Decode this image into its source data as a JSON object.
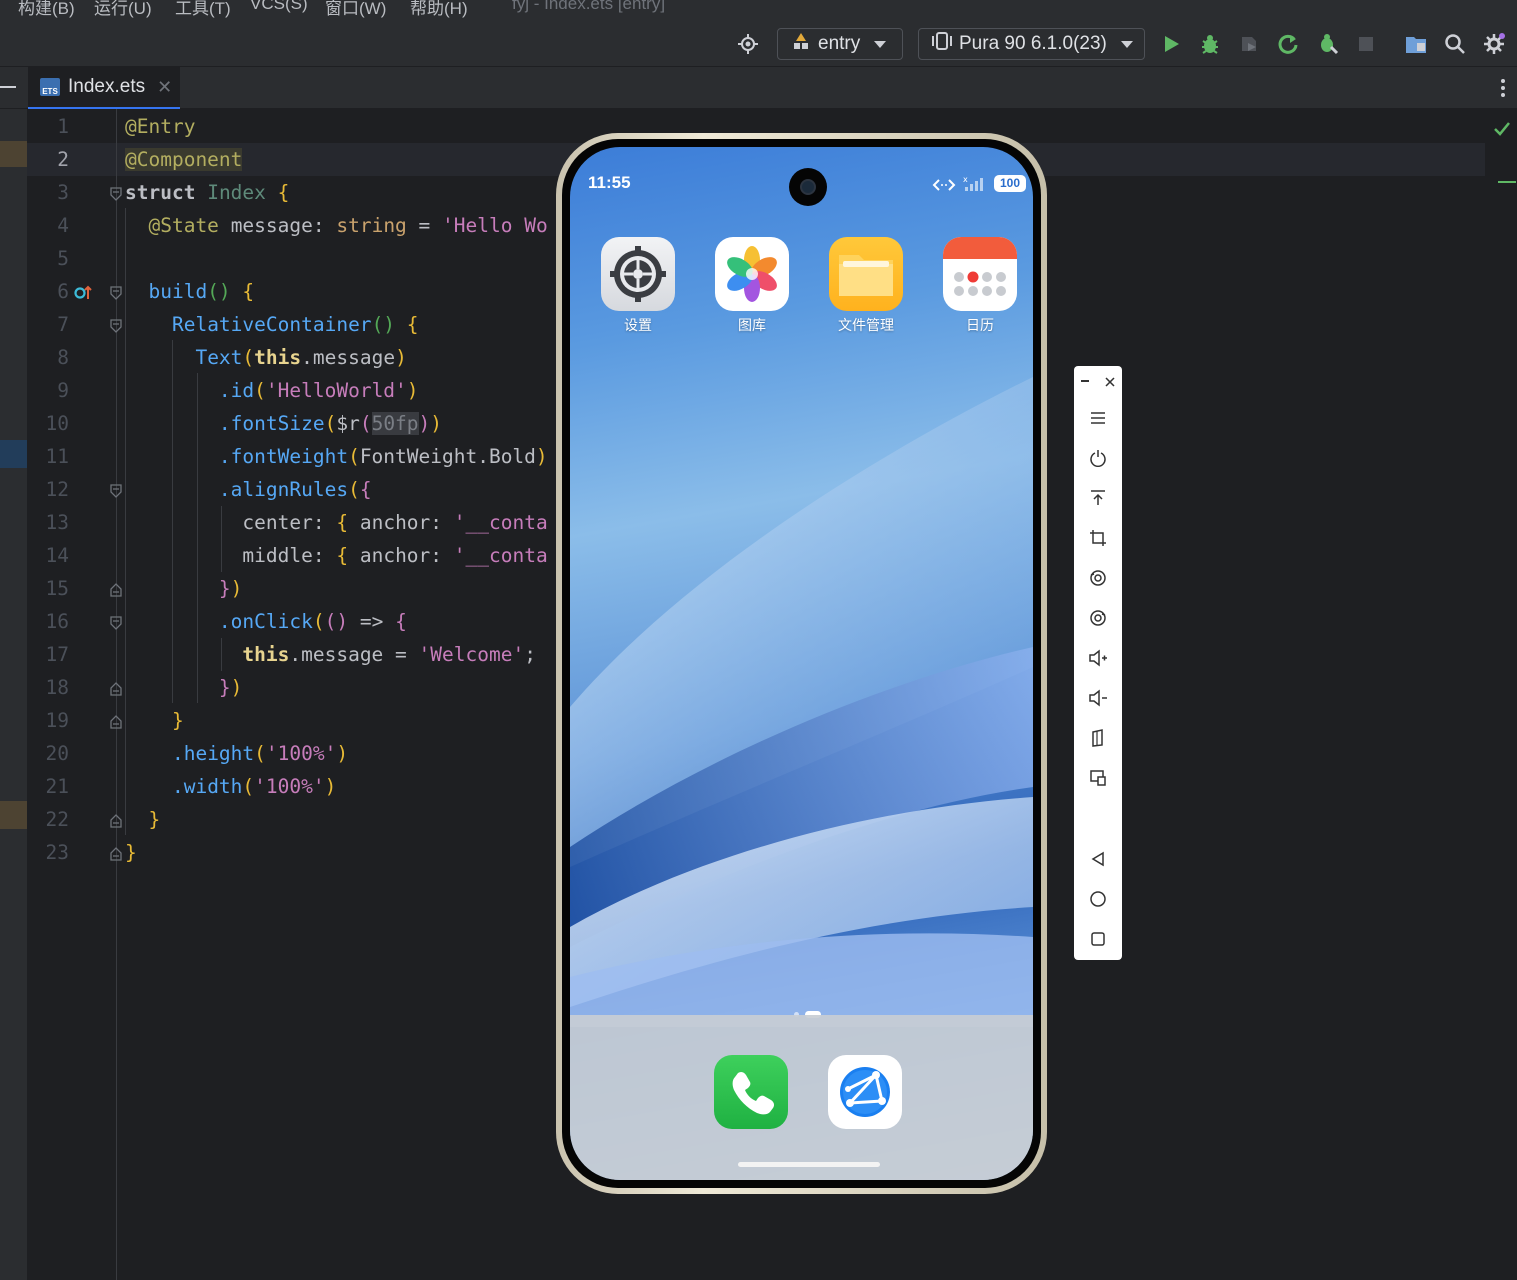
{
  "menubar": {
    "items": [
      "构建(B)",
      "运行(U)",
      "工具(T)",
      "VCS(S)",
      "窗口(W)",
      "帮助(H)"
    ],
    "window_title": "fyj - Index.ets [entry]"
  },
  "toolbar": {
    "module_combo": "entry",
    "device_combo": "Pura 90 6.1.0(23)"
  },
  "tabs": [
    {
      "label": "Index.ets",
      "active": true,
      "icon": "ets-file-icon",
      "badge": "ETS"
    }
  ],
  "editor": {
    "line_numbers": [
      "1",
      "2",
      "3",
      "4",
      "5",
      "6",
      "7",
      "8",
      "9",
      "10",
      "11",
      "12",
      "13",
      "14",
      "15",
      "16",
      "17",
      "18",
      "19",
      "20",
      "21",
      "22",
      "23"
    ],
    "lines": {
      "l1": "@Entry",
      "l2": "@Component",
      "l3_kw": "struct",
      "l3_name": "Index",
      "l3_brace": "{",
      "l4_ann": "@State",
      "l4_name": "message",
      "l4_type": "string",
      "l4_str": "'Hello Wo",
      "l6_fn": "build",
      "l7_fn": "RelativeContainer",
      "l8_fn": "Text",
      "l8_this": "this",
      "l8_prop": ".message",
      "l9_fn": ".id",
      "l9_str": "'HelloWorld'",
      "l10_fn": ".fontSize",
      "l10_r": "$r",
      "l10_arg": "50fp",
      "l11_fn": ".fontWeight",
      "l11_arg": "FontWeight.Bold",
      "l12_fn": ".alignRules",
      "l13_key": "center",
      "l13_anchor": "anchor",
      "l13_str": "'__conta",
      "l14_key": "middle",
      "l14_anchor": "anchor",
      "l14_str": "'__conta",
      "l16_fn": ".onClick",
      "l17_this": "this",
      "l17_prop": ".message",
      "l17_str": "'Welcome'",
      "l20_fn": ".height",
      "l20_str": "'100%'",
      "l21_fn": ".width",
      "l21_str": "'100%'"
    }
  },
  "phone": {
    "status_time": "11:55",
    "battery": "100",
    "apps": [
      {
        "label": "设置",
        "icon": "settings-icon"
      },
      {
        "label": "图库",
        "icon": "gallery-icon"
      },
      {
        "label": "文件管理",
        "icon": "files-icon"
      },
      {
        "label": "日历",
        "icon": "calendar-icon"
      }
    ],
    "dock": [
      {
        "icon": "phone-call-icon"
      },
      {
        "icon": "browser-icon"
      }
    ]
  },
  "colors": {
    "ide_bg": "#1e1f22",
    "ide_chrome": "#2b2d30",
    "accent": "#3574f0",
    "run_green": "#5fb865"
  }
}
